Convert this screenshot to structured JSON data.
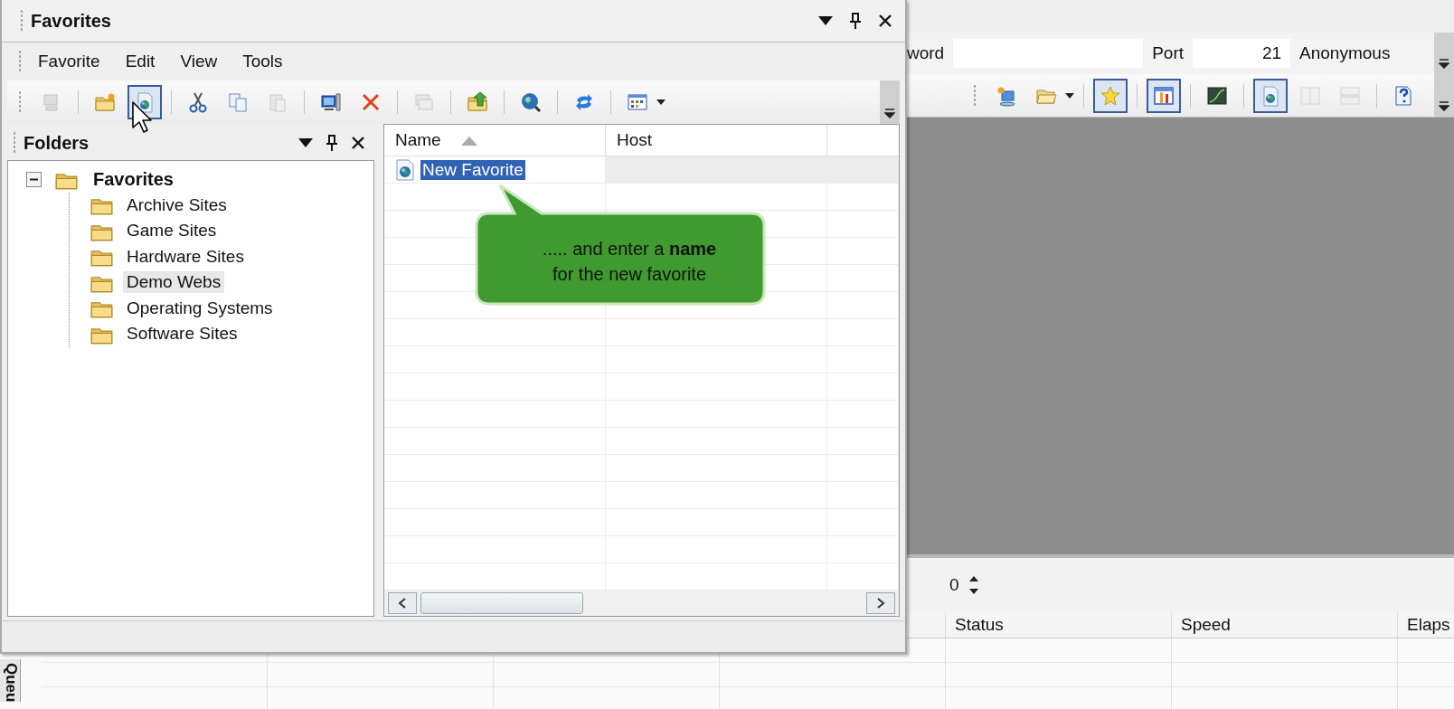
{
  "connection_bar": {
    "password_label": "word",
    "port_label": "Port",
    "port_value": "21",
    "anonymous_label": "Anonymous"
  },
  "main_toolbar": {
    "groups": [
      {
        "buttons": [
          {
            "kind": "new-connection",
            "pressed": false,
            "disabled": false,
            "dropdown": false
          },
          {
            "kind": "open-folder",
            "pressed": false,
            "disabled": false,
            "dropdown": true
          }
        ]
      },
      {
        "buttons": [
          {
            "kind": "star",
            "pressed": true,
            "disabled": false,
            "dropdown": false
          }
        ]
      },
      {
        "buttons": [
          {
            "kind": "transfer",
            "pressed": true,
            "disabled": false,
            "dropdown": false
          }
        ]
      },
      {
        "buttons": [
          {
            "kind": "chart",
            "pressed": false,
            "disabled": false,
            "dropdown": false
          }
        ]
      },
      {
        "buttons": [
          {
            "kind": "globe-page",
            "pressed": true,
            "disabled": false,
            "dropdown": false
          },
          {
            "kind": "split-vertical",
            "pressed": false,
            "disabled": true,
            "dropdown": false
          },
          {
            "kind": "split-horizontal",
            "pressed": false,
            "disabled": true,
            "dropdown": false
          }
        ]
      },
      {
        "buttons": [
          {
            "kind": "help",
            "pressed": false,
            "disabled": false,
            "dropdown": false
          }
        ]
      }
    ]
  },
  "transfer_panel": {
    "spinner_value": "0"
  },
  "queue": {
    "tab": "Queu",
    "columns": [
      "Status",
      "Speed",
      "Elaps"
    ]
  },
  "favorites_window": {
    "title": "Favorites",
    "menu": [
      "Favorite",
      "Edit",
      "View",
      "Tools"
    ],
    "toolbar": {
      "groups": [
        {
          "buttons": [
            {
              "kind": "connect",
              "pressed": false,
              "disabled": true,
              "dropdown": false
            }
          ]
        },
        {
          "buttons": [
            {
              "kind": "new-folder",
              "pressed": false,
              "disabled": false,
              "dropdown": false
            },
            {
              "kind": "globe-page",
              "pressed": true,
              "disabled": false,
              "dropdown": false
            }
          ]
        },
        {
          "buttons": [
            {
              "kind": "cut",
              "pressed": false,
              "disabled": false,
              "dropdown": false
            },
            {
              "kind": "copy",
              "pressed": false,
              "disabled": false,
              "dropdown": false
            },
            {
              "kind": "paste",
              "pressed": false,
              "disabled": true,
              "dropdown": false
            }
          ]
        },
        {
          "buttons": [
            {
              "kind": "properties",
              "pressed": false,
              "disabled": false,
              "dropdown": false
            },
            {
              "kind": "delete",
              "pressed": false,
              "disabled": false,
              "dropdown": false
            }
          ]
        },
        {
          "buttons": [
            {
              "kind": "windows",
              "pressed": false,
              "disabled": true,
              "dropdown": false
            }
          ]
        },
        {
          "buttons": [
            {
              "kind": "folder-up",
              "pressed": false,
              "disabled": false,
              "dropdown": false
            }
          ]
        },
        {
          "buttons": [
            {
              "kind": "globe-search",
              "pressed": false,
              "disabled": false,
              "dropdown": false
            }
          ]
        },
        {
          "buttons": [
            {
              "kind": "refresh",
              "pressed": false,
              "disabled": false,
              "dropdown": false
            }
          ]
        },
        {
          "buttons": [
            {
              "kind": "view",
              "pressed": false,
              "disabled": false,
              "dropdown": true
            }
          ]
        }
      ]
    },
    "folders_pane": {
      "title": "Folders",
      "tree": [
        {
          "label": "Favorites",
          "expanded": true,
          "selected": false,
          "children": [
            {
              "label": "Archive Sites",
              "selected": false
            },
            {
              "label": "Game Sites",
              "selected": false
            },
            {
              "label": "Hardware Sites",
              "selected": false
            },
            {
              "label": "Demo Webs",
              "selected": true
            },
            {
              "label": "Operating Systems",
              "selected": false
            },
            {
              "label": "Software Sites",
              "selected": false
            }
          ]
        }
      ]
    },
    "list": {
      "columns": [
        {
          "label": "Name",
          "sorted": true
        },
        {
          "label": "Host",
          "sorted": false
        }
      ],
      "rows": [
        {
          "name": "New Favorite",
          "selected": true
        }
      ]
    },
    "callout": {
      "lines": [
        "..... and enter a **name**",
        "for the new favorite"
      ]
    }
  }
}
